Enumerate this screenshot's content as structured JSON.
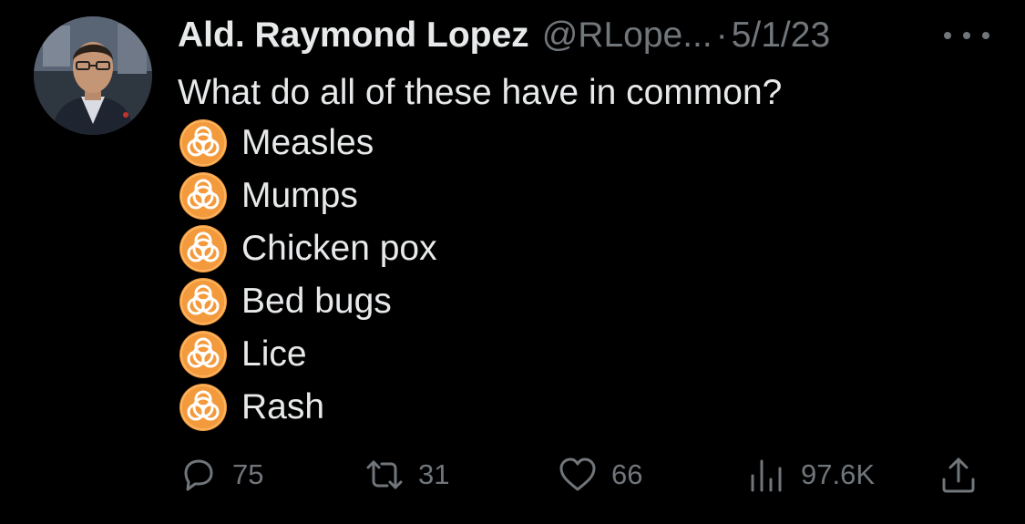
{
  "tweet": {
    "display_name": "Ald. Raymond Lopez",
    "handle": "@RLope...",
    "separator": "·",
    "date": "5/1/23",
    "text": "What do all of these have in common?",
    "list_icon": "biohazard-icon",
    "list": [
      "Measles",
      "Mumps",
      "Chicken pox",
      "Bed bugs",
      "Lice",
      "Rash"
    ]
  },
  "actions": {
    "replies": "75",
    "retweets": "31",
    "likes": "66",
    "views": "97.6K"
  },
  "colors": {
    "background": "#000000",
    "primary_text": "#e7e9ea",
    "secondary_text": "#71767b",
    "biohazard_orange": "#f39a3c"
  }
}
